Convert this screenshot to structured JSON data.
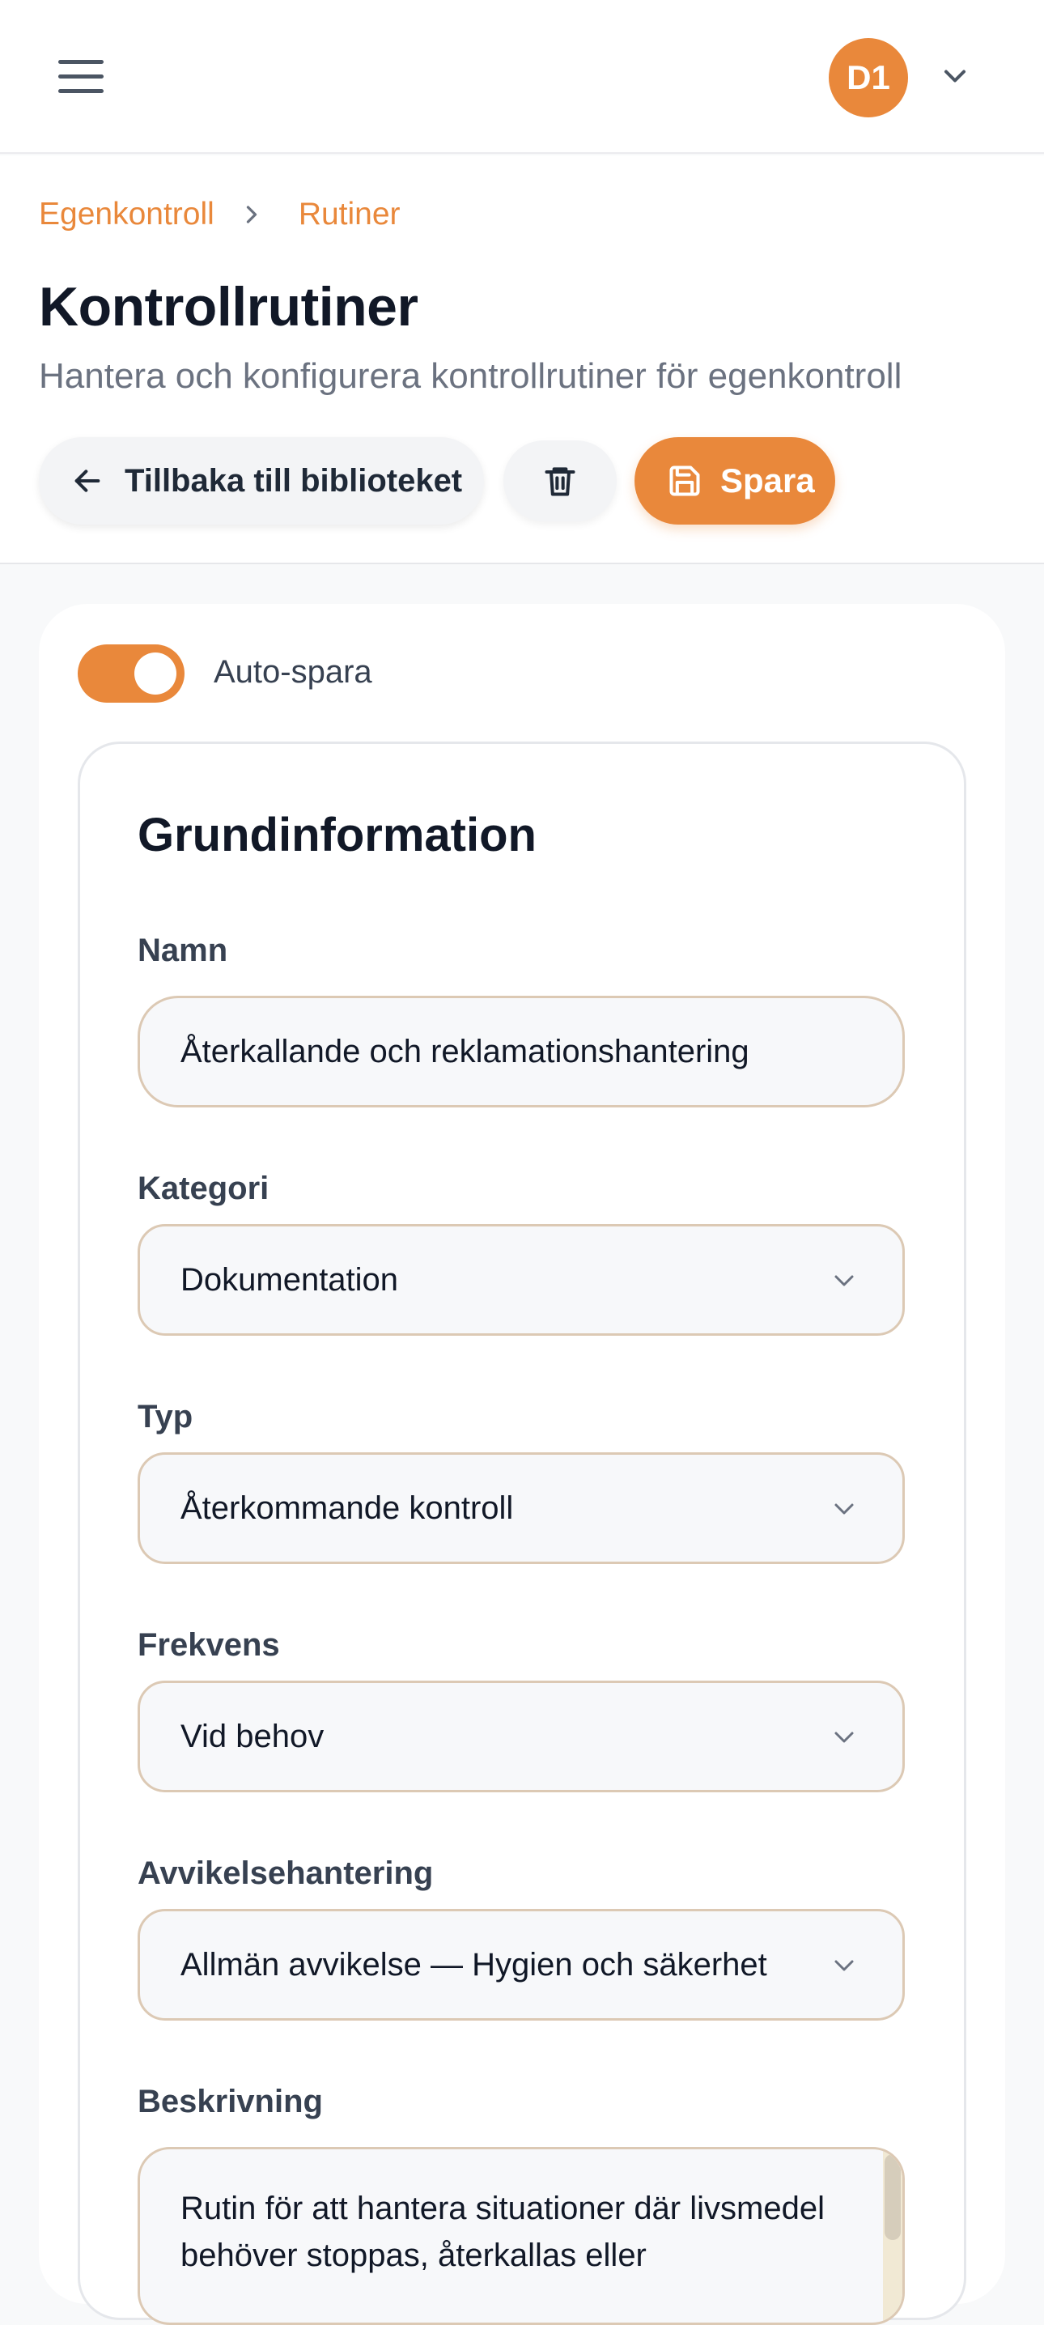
{
  "topbar": {
    "avatar_initials": "D1"
  },
  "breadcrumb": {
    "items": [
      "Egenkontroll",
      "Rutiner"
    ]
  },
  "header": {
    "title": "Kontrollrutiner",
    "subtitle": "Hantera och konfigurera kontrollrutiner för egenkontroll"
  },
  "actions": {
    "back_label": "Tillbaka till biblioteket",
    "save_label": "Spara"
  },
  "autosave": {
    "label": "Auto-spara",
    "enabled": true
  },
  "form": {
    "section_title": "Grundinformation",
    "name": {
      "label": "Namn",
      "value": "Återkallande och reklamationshantering"
    },
    "category": {
      "label": "Kategori",
      "value": "Dokumentation"
    },
    "type": {
      "label": "Typ",
      "value": "Återkommande kontroll"
    },
    "frequency": {
      "label": "Frekvens",
      "value": "Vid behov"
    },
    "deviation": {
      "label": "Avvikelsehantering",
      "value": "Allmän avvikelse — Hygien och säkerhet"
    },
    "description": {
      "label": "Beskrivning",
      "value": "Rutin för att hantera situationer där livsmedel behöver stoppas, återkallas eller"
    }
  },
  "colors": {
    "accent": "#e9883b",
    "field_border": "#dcc9b4",
    "text": "#111827",
    "muted": "#6b7280"
  },
  "icons": {
    "menu": "hamburger-icon",
    "user_dropdown": "chevron-down-icon",
    "breadcrumb_sep": "chevron-right-icon",
    "back": "arrow-left-icon",
    "delete": "trash-icon",
    "save": "floppy-disk-icon",
    "select": "chevron-down-icon"
  }
}
